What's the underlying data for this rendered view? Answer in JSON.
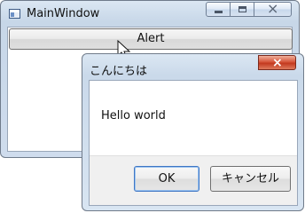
{
  "main_window": {
    "title": "MainWindow",
    "alert_button_label": "Alert"
  },
  "dialog": {
    "title": "こんにちは",
    "message": "Hello world",
    "ok_label": "OK",
    "cancel_label": "キャンセル"
  },
  "icons": {
    "app": "app-window-icon",
    "minimize": "minimize-icon",
    "maximize": "maximize-icon",
    "close": "close-icon",
    "cursor": "cursor-icon"
  },
  "colors": {
    "window_frame": "#cfdced",
    "close_button_active": "#c3391f",
    "button_face": "#e6e6e6",
    "default_button_border": "#3f76c4"
  }
}
